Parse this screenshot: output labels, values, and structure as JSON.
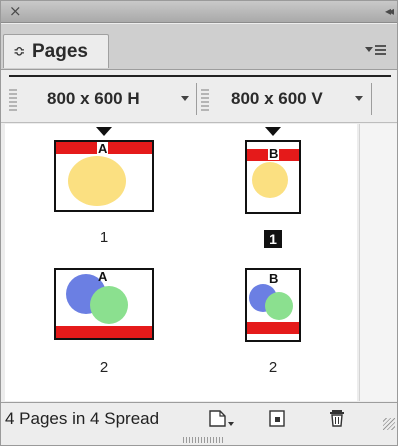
{
  "panel": {
    "close_glyph": "×",
    "collapse_glyph": "◂◂",
    "tab_icon": "double-arrow-icon",
    "tab_icon_glyph": "≎",
    "tab_label": "Pages",
    "menu_icon": "panel-menu-icon"
  },
  "toolbar": {
    "size_horizontal": "800 x 600 H",
    "size_vertical": "800 x 600 V"
  },
  "spreads": [
    {
      "master": "A",
      "label": "1",
      "active": false,
      "orientation": "horizontal"
    },
    {
      "master": "B",
      "label": "1",
      "active": true,
      "orientation": "vertical"
    },
    {
      "master": "A",
      "label": "2",
      "active": false,
      "orientation": "horizontal"
    },
    {
      "master": "B",
      "label": "2",
      "active": false,
      "orientation": "vertical"
    }
  ],
  "colors": {
    "band_red": "#e51a1a",
    "circle_yellow": "#fbe081",
    "circle_blue": "#6b7fe3",
    "circle_green": "#8be08f"
  },
  "footer": {
    "status": "4 Pages in 4 Spread",
    "buttons": [
      "new-page-size-icon",
      "new-page-icon",
      "trash-icon"
    ]
  }
}
